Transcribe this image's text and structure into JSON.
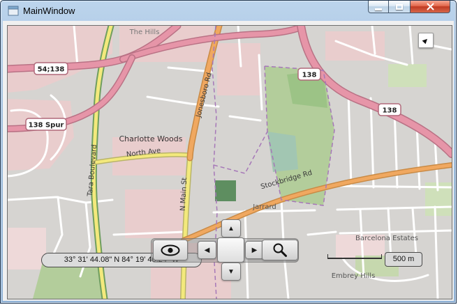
{
  "window": {
    "title": "MainWindow"
  },
  "icons": {
    "minimize": "minimize-bar",
    "maximize": "maximize-square",
    "close": "x-cross",
    "eye": "eye-outline",
    "magnifier": "magnifying-glass",
    "pointer_tool": "cursor-arrow",
    "pan_up": "▲",
    "pan_down": "▼",
    "pan_left": "◀",
    "pan_right": "▶"
  },
  "map": {
    "shields": {
      "route_54_138": "54;138",
      "route_138_spur": "138 Spur",
      "route_138_a": "138",
      "route_138_b": "138"
    },
    "streets": {
      "north_ave": "North Ave",
      "n_main_st": "N Main St",
      "tara_boulevard": "Tara Boulevard",
      "jonesboro_rd": "Jonesboro Rd",
      "stockbridge_rd": "Stockbridge Rd"
    },
    "places": {
      "the_hills": "The Hills",
      "charlotte_woods": "Charlotte Woods",
      "jarrard": "Jarrard",
      "barcelona_estates": "Barcelona Estates",
      "embrey_hills": "Embrey Hills"
    },
    "colors": {
      "land": "#d6d4d1",
      "residential": "#e9cdcd",
      "park": "#b3cd9b",
      "motorway": "#e695a8",
      "primary_road": "#f0a860",
      "secondary_road": "#f3e97c",
      "boundary": "#a678b8"
    }
  },
  "overlay": {
    "coordinates": "33° 31' 44.08\" N 84° 19' 46.24\" W",
    "scale_label": "500 m"
  }
}
